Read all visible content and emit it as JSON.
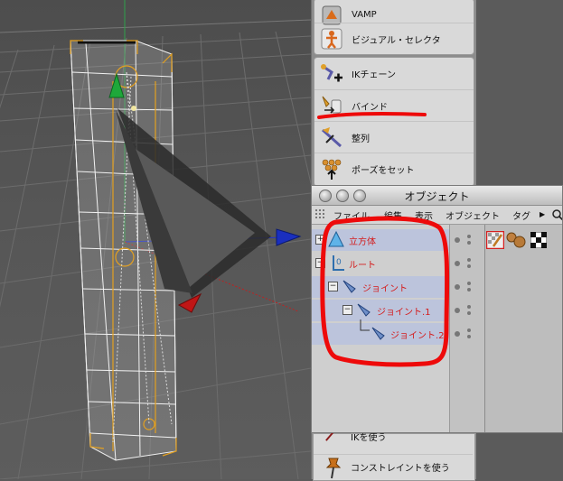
{
  "palette": {
    "items_top": [
      {
        "label": "VAMP",
        "icon": "vamp-icon"
      },
      {
        "label": "ビジュアル・セレクタ",
        "icon": "visual-selector-icon"
      }
    ],
    "items_mid": [
      {
        "label": "IKチェーン",
        "icon": "ik-chain-icon"
      },
      {
        "label": "バインド",
        "icon": "bind-icon"
      },
      {
        "label": "整列",
        "icon": "align-icon"
      },
      {
        "label": "ポーズをセット",
        "icon": "set-pose-icon"
      }
    ],
    "items_bottom": [
      {
        "label": "IKを使う",
        "icon": "use-ik-icon"
      },
      {
        "label": "コンストレイントを使う",
        "icon": "constraint-pin-icon"
      }
    ]
  },
  "object_manager": {
    "title": "オブジェクト",
    "menu": [
      "ファイル",
      "編集",
      "表示",
      "オブジェクト",
      "タグ"
    ],
    "objects": [
      {
        "name": "立方体",
        "icon": "cube-icon",
        "toggle": "+"
      },
      {
        "name": "ルート",
        "icon": "null-object-icon",
        "toggle": "−"
      },
      {
        "name": "ジョイント",
        "icon": "joint-icon",
        "toggle": "−"
      },
      {
        "name": "ジョイント.1",
        "icon": "joint-icon",
        "toggle": "−"
      },
      {
        "name": "ジョイント.2",
        "icon": "joint-icon",
        "toggle": ""
      }
    ],
    "tags": [
      "weight-tag-icon",
      "material-sphere-icon",
      "checker-texture-icon"
    ]
  },
  "colors": {
    "annotation_red": "#ee0a0a",
    "object_name_red": "#d41c1c",
    "selected_row": "#b9c1d9"
  }
}
